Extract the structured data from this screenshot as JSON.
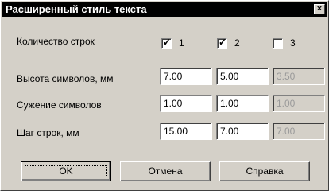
{
  "window": {
    "title": "Расширенный стиль текста",
    "close_glyph": "×"
  },
  "rows": {
    "line_count": {
      "label": "Количество строк",
      "checkboxes": [
        {
          "label": "1",
          "checked": true
        },
        {
          "label": "2",
          "checked": true
        },
        {
          "label": "3",
          "checked": false
        }
      ]
    },
    "char_height": {
      "label": "Высота символов, мм",
      "values": [
        "7.00",
        "5.00",
        "3.50"
      ]
    },
    "char_narrowing": {
      "label": "Сужение символов",
      "values": [
        "1.00",
        "1.00",
        "1.00"
      ]
    },
    "line_step": {
      "label": "Шаг строк, мм",
      "values": [
        "15.00",
        "7.00",
        "7.00"
      ]
    }
  },
  "buttons": {
    "ok": "OK",
    "cancel": "Отмена",
    "help": "Справка"
  }
}
